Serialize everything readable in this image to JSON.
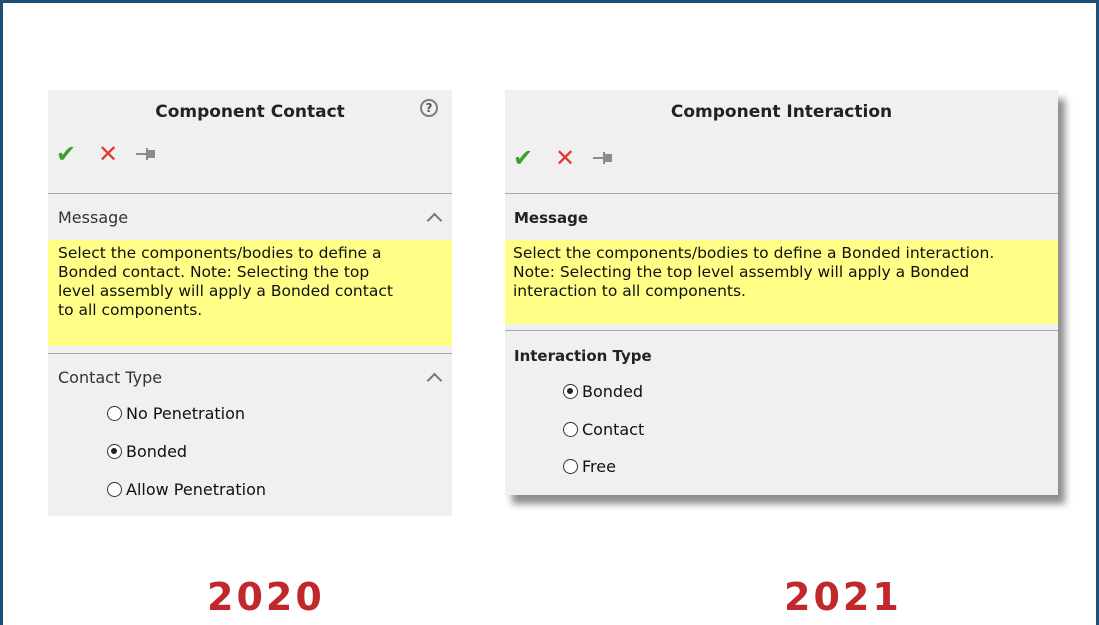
{
  "panel_2020": {
    "title": "Component Contact",
    "help_icon": "?",
    "message_header": "Message",
    "message_lines": [
      "Select the components/bodies to define a",
      "Bonded contact. Note: Selecting the top",
      "level assembly will apply a Bonded contact",
      "to all components."
    ],
    "type_header": "Contact Type",
    "options": [
      {
        "label": "No Penetration",
        "checked": false
      },
      {
        "label": "Bonded",
        "checked": true
      },
      {
        "label": "Allow Penetration",
        "checked": false
      }
    ],
    "year": "2020"
  },
  "panel_2021": {
    "title": "Component Interaction",
    "message_header": "Message",
    "message_lines": [
      "Select the components/bodies to define a Bonded interaction.",
      "Note: Selecting the top level assembly will apply a Bonded",
      "interaction to all components."
    ],
    "type_header": "Interaction Type",
    "options": [
      {
        "label": "Bonded",
        "checked": true
      },
      {
        "label": "Contact",
        "checked": false
      },
      {
        "label": "Free",
        "checked": false
      }
    ],
    "year": "2021"
  },
  "icons": {
    "ok": "✔",
    "cancel": "✕",
    "pin": "pin-icon"
  },
  "colors": {
    "frame_border": "#1f4e79",
    "panel_bg": "#f0f0f0",
    "message_bg": "#ffff88",
    "ok": "#3aa12a",
    "cancel": "#e03a2e",
    "year": "#c0282b"
  }
}
